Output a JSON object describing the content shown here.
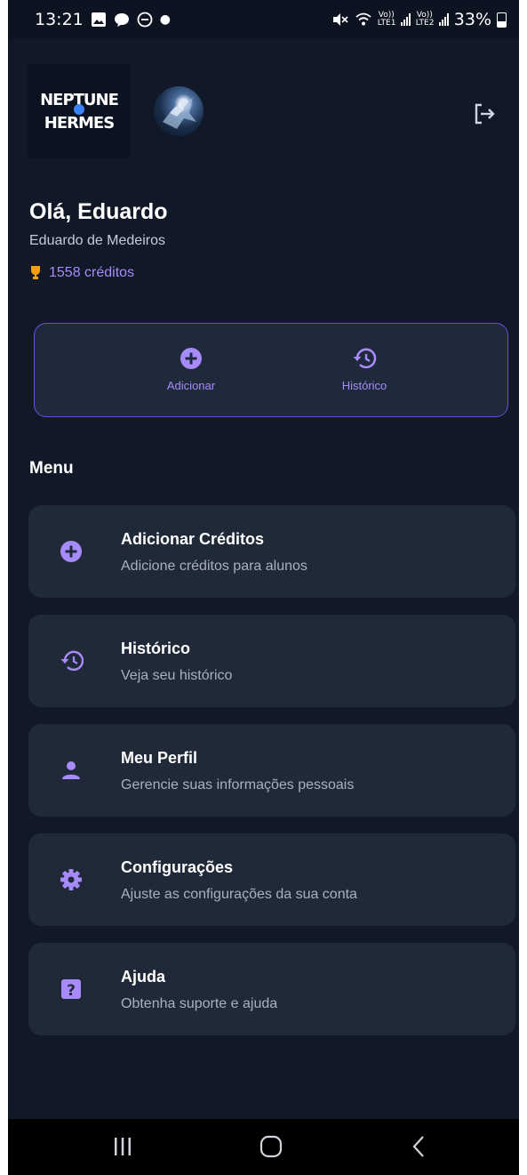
{
  "status_bar": {
    "time": "13:21",
    "battery_pct": "33%",
    "sim1": "Vo)) LTE1",
    "sim2": "Vo)) LTE2"
  },
  "header": {
    "logo_text": "NEPTUNE HERMES",
    "greeting": "Olá, Eduardo",
    "full_name": "Eduardo de Medeiros",
    "credits": "1558 créditos"
  },
  "quick_actions": [
    {
      "label": "Adicionar",
      "icon": "plus-circle-icon"
    },
    {
      "label": "Histórico",
      "icon": "history-icon"
    }
  ],
  "menu": {
    "title": "Menu",
    "items": [
      {
        "title": "Adicionar Créditos",
        "subtitle": "Adicione créditos para alunos",
        "icon": "plus-circle-icon"
      },
      {
        "title": "Histórico",
        "subtitle": "Veja seu histórico",
        "icon": "history-icon"
      },
      {
        "title": "Meu Perfil",
        "subtitle": "Gerencie suas informações pessoais",
        "icon": "person-icon"
      },
      {
        "title": "Configurações",
        "subtitle": "Ajuste as configurações da sua conta",
        "icon": "gear-icon"
      },
      {
        "title": "Ajuda",
        "subtitle": "Obtenha suporte e ajuda",
        "icon": "help-icon"
      }
    ]
  },
  "colors": {
    "background": "#111827",
    "card": "#1f2937",
    "accent": "#a78bfa",
    "accent_border": "#6d4ee0"
  }
}
